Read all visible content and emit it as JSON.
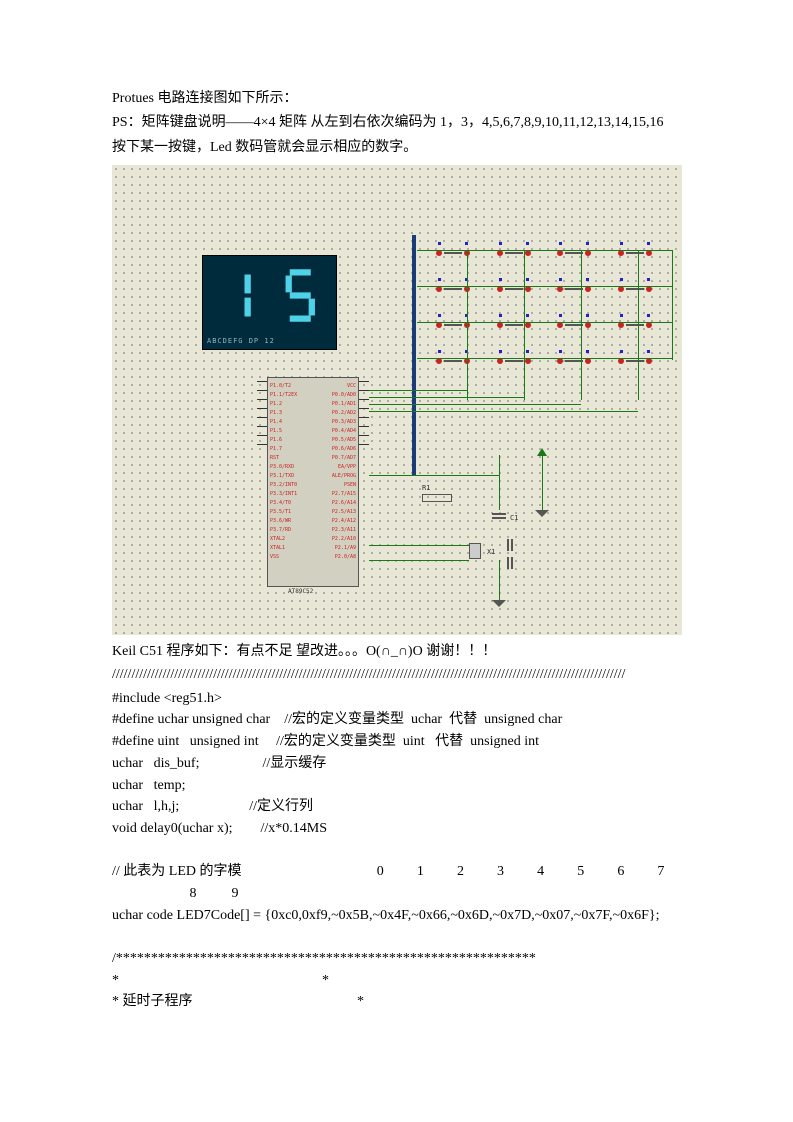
{
  "intro": {
    "line1": "Protues 电路连接图如下所示：",
    "line2": "PS：矩阵键盘说明——4×4 矩阵 从左到右依次编码为 1，3，4,5,6,7,8,9,10,11,12,13,14,15,16",
    "line3": "按下某一按键，Led 数码管就会显示相应的数字。"
  },
  "schematic": {
    "display_value": "15",
    "display_label": "ABCDEFG DP  12",
    "mcu": {
      "left_pins": [
        "P1.0/T2",
        "P1.1/T2EX",
        "P1.2",
        "P1.3",
        "P1.4",
        "P1.5",
        "P1.6",
        "P1.7",
        "RST",
        "P3.0/RXD",
        "P3.1/TXD",
        "P3.2/INT0",
        "P3.3/INT1",
        "P3.4/T0",
        "P3.5/T1",
        "P3.6/WR",
        "P3.7/RD",
        "XTAL2",
        "XTAL1",
        "VSS"
      ],
      "right_pins": [
        "VCC",
        "P0.0/AD0",
        "P0.1/AD1",
        "P0.2/AD2",
        "P0.3/AD3",
        "P0.4/AD4",
        "P0.5/AD5",
        "P0.6/AD6",
        "P0.7/AD7",
        "EA/VPP",
        "ALE/PROG",
        "PSEN",
        "P2.7/A15",
        "P2.6/A14",
        "P2.5/A13",
        "P2.4/A12",
        "P2.3/A11",
        "P2.2/A10",
        "P2.1/A9",
        "P2.0/A8"
      ],
      "part_label": "AT89C52"
    },
    "components": {
      "r1": "R1",
      "c1": "C1",
      "x1": "X1"
    }
  },
  "after_schematic": "Keil C51 程序如下：有点不足 望改进。。。O(∩_∩)O 谢谢！！！",
  "separator": "////////////////////////////////////////////////////////////////////////////////////////////////////////////////////////////////////",
  "code": {
    "l1": "#include <reg51.h>",
    "l2a": "#define uchar unsigned char",
    "l2b": "//宏的定义变量类型  uchar  代替  unsigned char",
    "l3a": "#define uint   unsigned int",
    "l3b": "//宏的定义变量类型  uint   代替  unsigned int",
    "l4a": "uchar   dis_buf;",
    "l4b": "//显示缓存",
    "l5": "uchar   temp;",
    "l6a": "uchar   l,h,j;",
    "l6b": "//定义行列",
    "l7a": "void delay0(uchar x);",
    "l7b": "//x*0.14MS",
    "table_pre": "// 此表为 LED 的字模",
    "table_nums_row1": [
      "0",
      "1",
      "2",
      "3",
      "4",
      "5",
      "6",
      "7"
    ],
    "table_nums_row2": [
      "8",
      "9"
    ],
    "led_code": "uchar code LED7Code[] = {0xc0,0xf9,~0x5B,~0x4F,~0x66,~0x6D,~0x7D,~0x07,~0x7F,~0x6F};",
    "comment_block": {
      "top": "/************************************************************",
      "blank": "*                                                          *",
      "title": "* 延时子程序                                               *"
    }
  }
}
